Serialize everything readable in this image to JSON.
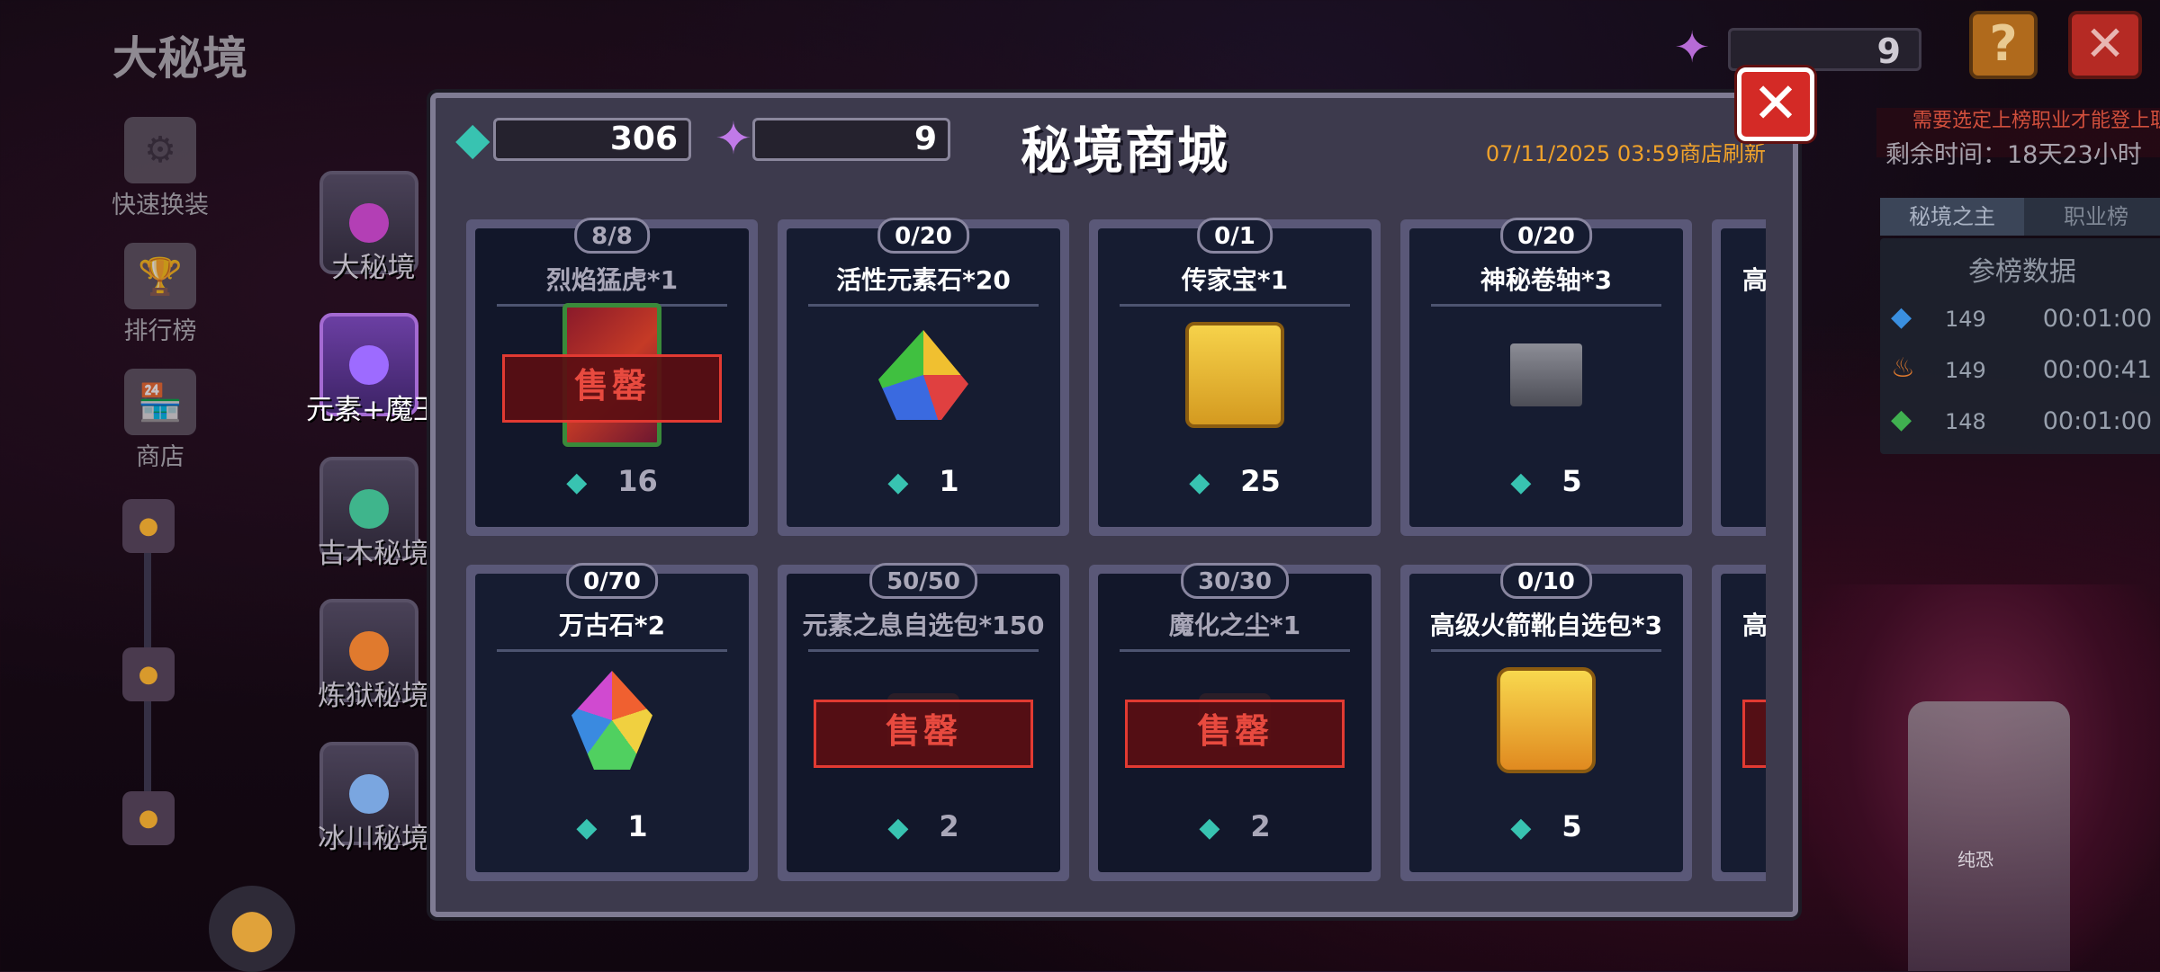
{
  "background": {
    "title": "大秘境",
    "left_menu": [
      {
        "label": "快速换装",
        "icon": "swap-gear-icon"
      },
      {
        "label": "排行榜",
        "icon": "trophy-icon"
      },
      {
        "label": "商店",
        "icon": "shop-icon"
      }
    ],
    "towers": [
      {
        "label": "大秘境",
        "active": false,
        "color": "#b33fb5"
      },
      {
        "label": "元素+魔王",
        "active": true,
        "color": "#9d6bff"
      },
      {
        "label": "古木秘境",
        "active": false,
        "color": "#3fb58c"
      },
      {
        "label": "炼狱秘境",
        "active": false,
        "color": "#e07a2e"
      },
      {
        "label": "冰川秘境",
        "active": false,
        "color": "#7aa6e0"
      }
    ],
    "top_right_currency": "9",
    "help_label": "?",
    "close_label": "✕",
    "right_panel": {
      "banner": "需要选定上榜职业才能登上职业榜",
      "remaining": "剩余时间：18天23小时",
      "tabs": [
        "秘境之主",
        "职业榜"
      ],
      "active_tab": 0,
      "table_title": "参榜数据",
      "rows": [
        {
          "icon": "blue-crystal-icon",
          "num": "149",
          "time": "00:01:00",
          "color": "#3a8fe0"
        },
        {
          "icon": "flame-icon",
          "num": "149",
          "time": "00:00:41",
          "color": "#e07a2e"
        },
        {
          "icon": "green-crystal-icon",
          "num": "148",
          "time": "00:01:00",
          "color": "#40b050"
        }
      ]
    },
    "boss_label": "纯恐"
  },
  "shop": {
    "title": "秘境商城",
    "currency_gem": "306",
    "currency_purple": "9",
    "refresh_text": "07/11/2025 03:59商店刷新",
    "close_label": "✕",
    "sold_out_label": "售罄",
    "items": [
      {
        "stock": "8/8",
        "name": "烈焰猛虎*1",
        "price": "16",
        "sold_out": true,
        "icon": "flame-tiger-icon",
        "art": "it-tiger"
      },
      {
        "stock": "0/20",
        "name": "活性元素石*20",
        "price": "1",
        "sold_out": false,
        "icon": "element-stone-icon",
        "art": "it-gems"
      },
      {
        "stock": "0/1",
        "name": "传家宝*1",
        "price": "25",
        "sold_out": false,
        "icon": "heirloom-chest-icon",
        "art": "it-chest"
      },
      {
        "stock": "0/20",
        "name": "神秘卷轴*3",
        "price": "5",
        "sold_out": false,
        "icon": "mystery-scroll-icon",
        "art": "it-scroll"
      },
      {
        "stock": "",
        "name": "高级",
        "price": "",
        "sold_out": false,
        "icon": "partial-item-icon",
        "art": ""
      },
      {
        "stock": "0/70",
        "name": "万古石*2",
        "price": "1",
        "sold_out": false,
        "icon": "ancient-stone-icon",
        "art": "it-stone"
      },
      {
        "stock": "50/50",
        "name": "元素之息自选包*150",
        "price": "2",
        "sold_out": true,
        "icon": "element-breath-pack-icon",
        "art": "it-dim"
      },
      {
        "stock": "30/30",
        "name": "魔化之尘*1",
        "price": "2",
        "sold_out": true,
        "icon": "demon-dust-icon",
        "art": "it-dim"
      },
      {
        "stock": "0/10",
        "name": "高级火箭靴自选包*3",
        "price": "5",
        "sold_out": false,
        "icon": "rocket-boots-pack-icon",
        "art": "it-boot"
      },
      {
        "stock": "",
        "name": "高",
        "price": "",
        "sold_out": true,
        "icon": "partial-item-icon",
        "art": ""
      }
    ]
  }
}
